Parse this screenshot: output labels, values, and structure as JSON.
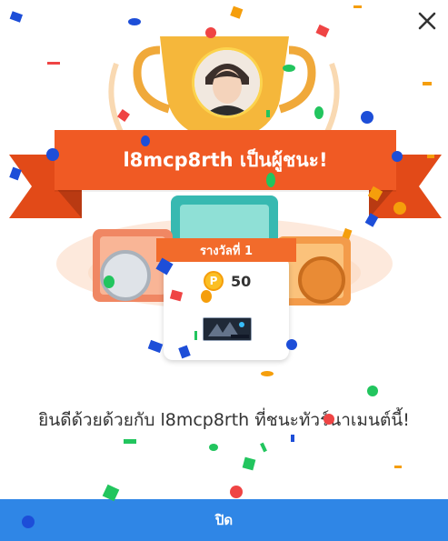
{
  "header": {
    "close_icon": "close-icon"
  },
  "winner": {
    "banner": "l8mcp8rth เป็นผู้ชนะ!",
    "avatar_icon": "avatar"
  },
  "prize": {
    "rank_label": "รางวัลที่ 1",
    "coin_icon": "coin-icon",
    "coin_symbol": "P",
    "coin_amount": "50",
    "item_icon": "item-thumbnail"
  },
  "message": "ยินดีด้วยด้วยกับ l8mcp8rth ที่ชนะทัวร์นาเมนต์นี้!",
  "footer": {
    "close_label": "ปิด"
  },
  "colors": {
    "accent_orange": "#f05a24",
    "gold": "#f5b73b",
    "button_blue": "#2f86e6"
  }
}
